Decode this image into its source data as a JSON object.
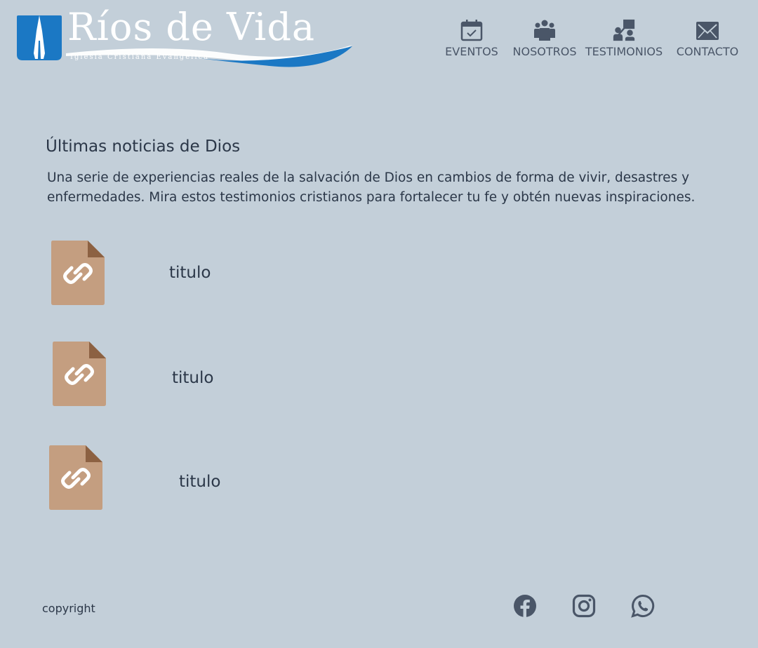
{
  "brand": {
    "title": "Ríos de Vida",
    "subtitle": "Iglesia Cristiana Evangelica"
  },
  "nav": [
    {
      "label": "EVENTOS",
      "icon": "calendar-check-icon"
    },
    {
      "label": "NOSOTROS",
      "icon": "people-group-icon"
    },
    {
      "label": "TESTIMONIOS",
      "icon": "speaker-icon"
    },
    {
      "label": "CONTACTO",
      "icon": "envelope-icon"
    }
  ],
  "section": {
    "heading": "Últimas noticias de Dios",
    "description": "Una serie de experiencias reales de la salvación de Dios en cambios de forma de vivir, desastres y enfermedades.  Mira estos testimonios cristianos para fortalecer tu fe y obtén nuevas inspiraciones."
  },
  "items": [
    {
      "title": "titulo",
      "icon": "link-document-icon"
    },
    {
      "title": "titulo",
      "icon": "link-document-icon"
    },
    {
      "title": "titulo",
      "icon": "link-document-icon"
    }
  ],
  "footer": {
    "copyright": "copyright",
    "social": [
      "facebook-icon",
      "instagram-icon",
      "whatsapp-icon"
    ]
  },
  "colors": {
    "background": "#c3cfd9",
    "text": "#2b3748",
    "brand_blue": "#1b78c4",
    "doc_fill": "#c49e80",
    "doc_fold": "#8c6142",
    "icon_gray": "#4a5668"
  }
}
